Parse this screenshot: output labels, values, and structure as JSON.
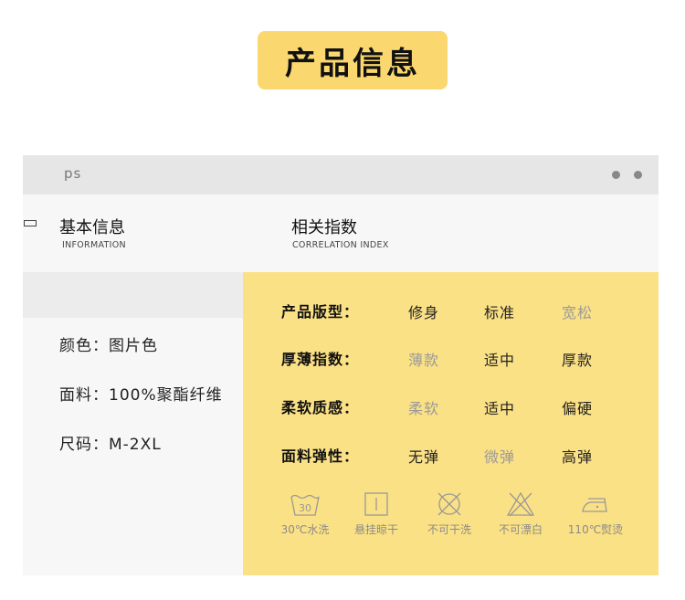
{
  "page_title": "产品信息",
  "window": {
    "tab_label": "ps"
  },
  "basic_info": {
    "title": "基本信息",
    "subtitle": "INFORMATION",
    "items": [
      {
        "text": "颜色：图片色"
      },
      {
        "text": "面料：100%聚酯纤维"
      },
      {
        "text": "尺码：M-2XL"
      }
    ]
  },
  "correlation_index": {
    "title": "相关指数",
    "subtitle": "CORRELATION INDEX",
    "rows": [
      {
        "label": "产品版型：",
        "options": [
          {
            "text": "修身",
            "selected": true
          },
          {
            "text": "标准",
            "selected": true
          },
          {
            "text": "宽松",
            "selected": false
          }
        ]
      },
      {
        "label": "厚薄指数：",
        "options": [
          {
            "text": "薄款",
            "selected": false
          },
          {
            "text": "适中",
            "selected": true
          },
          {
            "text": "厚款",
            "selected": true
          }
        ]
      },
      {
        "label": "柔软质感：",
        "options": [
          {
            "text": "柔软",
            "selected": false
          },
          {
            "text": "适中",
            "selected": true
          },
          {
            "text": "偏硬",
            "selected": true
          }
        ]
      },
      {
        "label": "面料弹性：",
        "options": [
          {
            "text": "无弹",
            "selected": true
          },
          {
            "text": "微弹",
            "selected": false
          },
          {
            "text": "高弹",
            "selected": true
          }
        ]
      }
    ]
  },
  "care_icons": [
    {
      "icon": "wash-30-icon",
      "label": "30℃水洗",
      "tub_text": "30"
    },
    {
      "icon": "hang-dry-icon",
      "label": "悬挂晾干"
    },
    {
      "icon": "no-dry-clean-icon",
      "label": "不可干洗"
    },
    {
      "icon": "no-bleach-icon",
      "label": "不可漂白"
    },
    {
      "icon": "iron-110-icon",
      "label": "110℃熨烫"
    }
  ],
  "colors": {
    "accent_yellow": "#fbd86f",
    "panel_yellow": "#fbe185",
    "dim_text": "#9a9a9a"
  }
}
